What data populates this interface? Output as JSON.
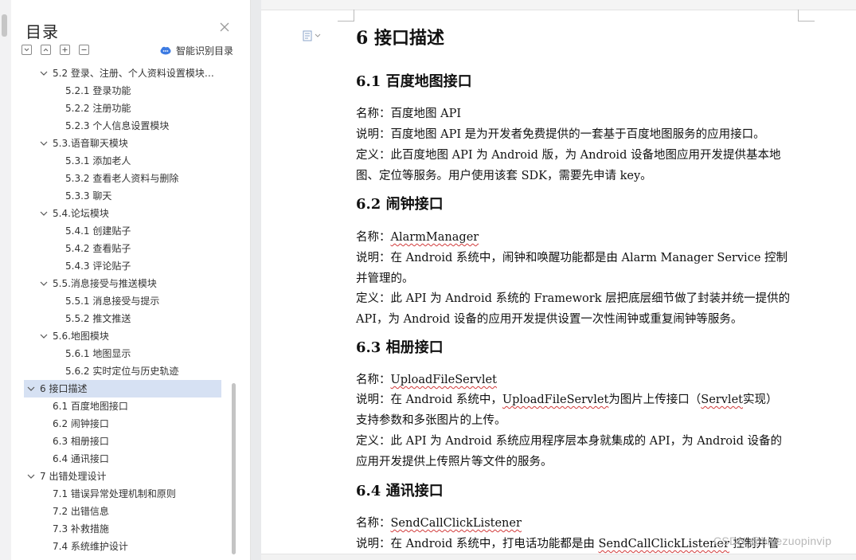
{
  "toc": {
    "title": "目录",
    "smart_label": "智能识别目录",
    "items": [
      {
        "label": "5.2 登录、注册、个人资料设置模块 ..."
      },
      {
        "label": "5.2.1 登录功能"
      },
      {
        "label": "5.2.2 注册功能"
      },
      {
        "label": "5.2.3 个人信息设置模块"
      },
      {
        "label": "5.3.语音聊天模块"
      },
      {
        "label": "5.3.1 添加老人"
      },
      {
        "label": "5.3.2 查看老人资料与删除"
      },
      {
        "label": "5.3.3 聊天"
      },
      {
        "label": "5.4.论坛模块"
      },
      {
        "label": "5.4.1 创建贴子"
      },
      {
        "label": "5.4.2 查看贴子"
      },
      {
        "label": "5.4.3 评论贴子"
      },
      {
        "label": "5.5.消息接受与推送模块"
      },
      {
        "label": "5.5.1 消息接受与提示"
      },
      {
        "label": "5.5.2 推文推送"
      },
      {
        "label": "5.6.地图模块"
      },
      {
        "label": "5.6.1 地图显示"
      },
      {
        "label": "5.6.2 实时定位与历史轨迹"
      },
      {
        "label": "6 接口描述"
      },
      {
        "label": "6.1 百度地图接口"
      },
      {
        "label": "6.2 闹钟接口"
      },
      {
        "label": "6.3 相册接口"
      },
      {
        "label": "6.4 通讯接口"
      },
      {
        "label": "7 出错处理设计"
      },
      {
        "label": "7.1 错误异常处理机制和原则"
      },
      {
        "label": "7.2 出错信息"
      },
      {
        "label": "7.3 补救措施"
      },
      {
        "label": "7.4 系统维护设计"
      }
    ]
  },
  "doc": {
    "h1": "6 接口描述",
    "s61": {
      "title": "6.1 百度地图接口",
      "l1": "名称：百度地图 API",
      "l2": "说明：百度地图 API 是为开发者免费提供的一套基于百度地图服务的应用接口。",
      "l3": "定义：此百度地图 API 为 Android 版，为 Android 设备地图应用开发提供基本地",
      "l4": "图、定位等服务。用户使用该套 SDK，需要先申请 key。"
    },
    "s62": {
      "title": "6.2 闹钟接口",
      "l1_prefix": "名称：",
      "l1_name": "AlarmManager",
      "l2": "说明：在 Android 系统中，闹钟和唤醒功能都是由 Alarm Manager Service 控制",
      "l3": "并管理的。",
      "l4": "定义：此 API 为 Android 系统的 Framework 层把底层细节做了封装并统一提供的",
      "l5": "API，为 Android 设备的应用开发提供设置一次性闹钟或重复闹钟等服务。"
    },
    "s63": {
      "title": "6.3 相册接口",
      "l1_prefix": "名称：",
      "l1_name": "UploadFileServlet",
      "l2_a": "说明：在 Android 系统中，",
      "l2_b": "UploadFileServlet",
      "l2_c": "为图片上传接口（",
      "l2_d": "Servlet",
      "l2_e": "实现）",
      "l3": "支持参数和多张图片的上传。",
      "l4": "定义：此 API 为 Android 系统应用程序层本身就集成的 API，为 Android 设备的",
      "l5": "应用开发提供上传照片等文件的服务。"
    },
    "s64": {
      "title": "6.4 通讯接口",
      "l1_prefix": "名称：",
      "l1_name": "SendCallClickListener",
      "l2_a": "说明：在 Android 系统中，打电话功能都是由 ",
      "l2_b": "SendCallClickListener",
      "l2_c": " 控制并管"
    },
    "watermark": "CSDN @biyezuopinvip"
  },
  "colors": {
    "active_bg": "#d6e1f3",
    "squiggle": "#d23b3b",
    "smart_icon": "#3d7be2"
  }
}
